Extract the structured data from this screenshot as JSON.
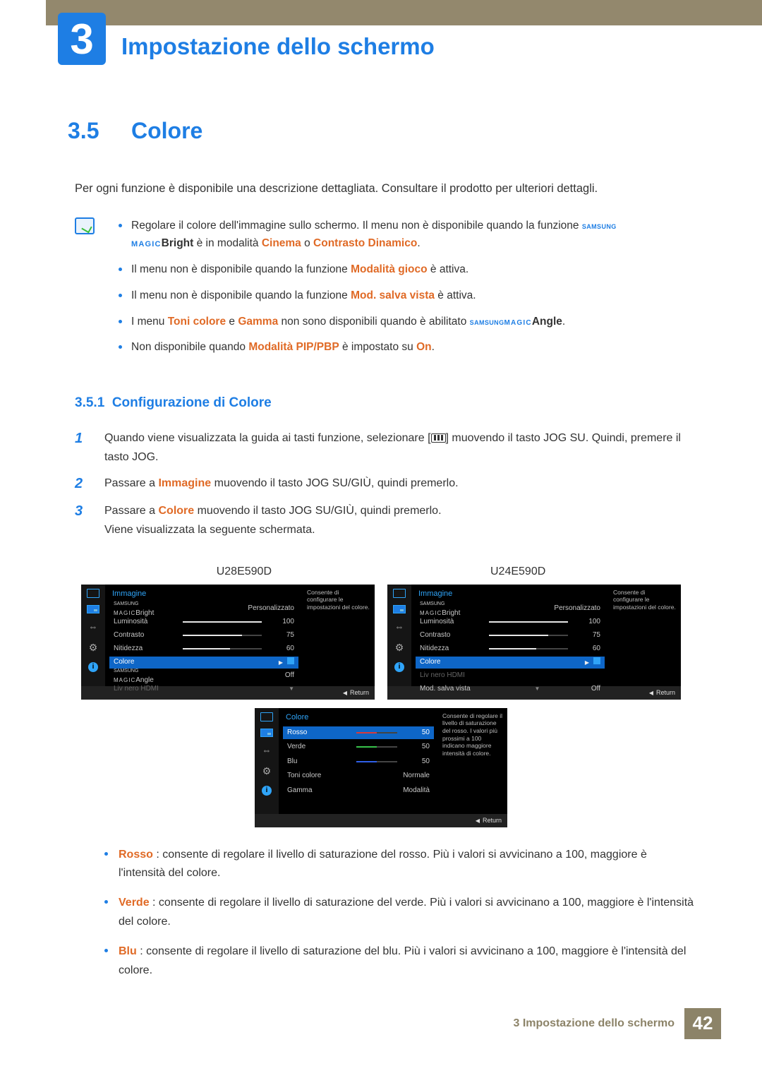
{
  "chapter": {
    "number": "3",
    "title": "Impostazione dello schermo"
  },
  "section": {
    "number": "3.5",
    "title": "Colore"
  },
  "intro": "Per ogni funzione è disponibile una descrizione dettagliata. Consultare il prodotto per ulteriori dettagli.",
  "notes": {
    "n1a": "Regolare il colore dell'immagine sullo schermo. Il menu non è disponibile quando la funzione ",
    "n1_samsung": "SAMSUNG",
    "n1_magic": "MAGIC",
    "n1_bright": "Bright",
    "n1b": " è in modalità ",
    "n1c": "Cinema",
    "n1d": " o ",
    "n1e": "Contrasto Dinamico",
    "n2a": "Il menu non è disponibile quando la funzione ",
    "n2b": "Modalità gioco",
    "n2c": " è attiva.",
    "n3a": "Il menu non è disponibile quando la funzione ",
    "n3b": "Mod. salva vista",
    "n3c": " è attiva.",
    "n4a": "I menu ",
    "n4b": "Toni colore",
    "n4c": " e ",
    "n4d": "Gamma",
    "n4e": " non sono disponibili quando è abilitato ",
    "n4_angle": "Angle",
    "n5a": "Non disponibile quando ",
    "n5b": "Modalità PIP/PBP",
    "n5c": " è impostato su ",
    "n5d": "On"
  },
  "subsection": {
    "number": "3.5.1",
    "title": "Configurazione di Colore"
  },
  "steps": {
    "s1": {
      "n": "1",
      "a": "Quando viene visualizzata la guida ai tasti funzione, selezionare [",
      "b": "] muovendo il tasto JOG SU. Quindi, premere il tasto JOG."
    },
    "s2": {
      "n": "2",
      "a": "Passare a ",
      "hl": "Immagine",
      "b": " muovendo il tasto JOG SU/GIÙ, quindi premerlo."
    },
    "s3": {
      "n": "3",
      "a": "Passare a ",
      "hl": "Colore",
      "b": " muovendo il tasto JOG SU/GIÙ, quindi premerlo.",
      "c": "Viene visualizzata la seguente schermata."
    }
  },
  "models": {
    "left": "U28E590D",
    "right": "U24E590D"
  },
  "osd_left": {
    "title": "Immagine",
    "rows": {
      "bright": {
        "l_s": "SAMSUNG",
        "l_m": "MAGIC",
        "l_b": "Bright",
        "v": "Personalizzato"
      },
      "lum": {
        "l": "Luminosità",
        "v": "100",
        "pct": 100
      },
      "con": {
        "l": "Contrasto",
        "v": "75",
        "pct": 75
      },
      "nit": {
        "l": "Nitidezza",
        "v": "60",
        "pct": 60
      },
      "col": {
        "l": "Colore"
      },
      "angle": {
        "l_s": "SAMSUNG",
        "l_m": "MAGIC",
        "l_a": "Angle",
        "v": "Off"
      },
      "hdmi": {
        "l": "Liv nero HDMI"
      }
    },
    "desc": "Consente di configurare le impostazioni del colore.",
    "return": "Return"
  },
  "osd_right": {
    "title": "Immagine",
    "rows": {
      "bright": {
        "l_s": "SAMSUNG",
        "l_m": "MAGIC",
        "l_b": "Bright",
        "v": "Personalizzato"
      },
      "lum": {
        "l": "Luminosità",
        "v": "100",
        "pct": 100
      },
      "con": {
        "l": "Contrasto",
        "v": "75",
        "pct": 75
      },
      "nit": {
        "l": "Nitidezza",
        "v": "60",
        "pct": 60
      },
      "col": {
        "l": "Colore"
      },
      "hdmi": {
        "l": "Liv nero HDMI"
      },
      "salva": {
        "l": "Mod. salva vista",
        "v": "Off"
      }
    },
    "desc": "Consente di configurare le impostazioni del colore.",
    "return": "Return"
  },
  "osd_color": {
    "title": "Colore",
    "rows": {
      "rosso": {
        "l": "Rosso",
        "v": "50",
        "pct": 50
      },
      "verde": {
        "l": "Verde",
        "v": "50",
        "pct": 50
      },
      "blu": {
        "l": "Blu",
        "v": "50",
        "pct": 50
      },
      "toni": {
        "l": "Toni colore",
        "v": "Normale"
      },
      "gamma": {
        "l": "Gamma",
        "v": "Modalità"
      }
    },
    "desc": "Consente di regolare il livello di saturazione del rosso. I valori più prossimi a 100 indicano maggiore intensità di colore.",
    "return": "Return"
  },
  "color_bullets": {
    "rosso": {
      "hl": "Rosso",
      "t": " : consente di regolare il livello di saturazione del rosso. Più i valori si avvicinano a 100, maggiore è l'intensità del colore."
    },
    "verde": {
      "hl": "Verde",
      "t": " : consente di regolare il livello di saturazione del verde. Più i valori si avvicinano a 100, maggiore è l'intensità del colore."
    },
    "blu": {
      "hl": "Blu",
      "t": " : consente di regolare il livello di saturazione del blu. Più i valori si avvicinano a 100, maggiore è l'intensità del colore."
    }
  },
  "footer": {
    "text": "3 Impostazione dello schermo",
    "page": "42"
  }
}
